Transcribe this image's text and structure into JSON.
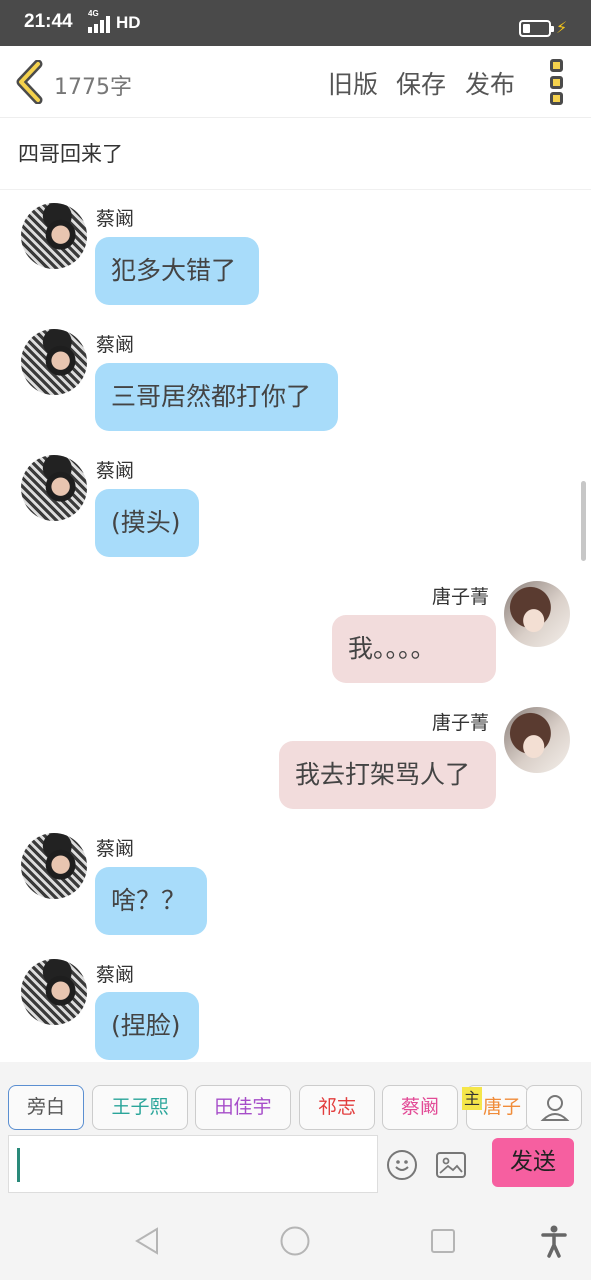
{
  "status": {
    "time": "21:44",
    "network_type": "4G",
    "signal_label": "HD"
  },
  "top_bar": {
    "word_count": "1775字",
    "actions": [
      "旧版",
      "保存",
      "发布"
    ]
  },
  "chapter": {
    "title": "四哥回来了"
  },
  "messages": [
    {
      "side": "left",
      "sender": "蔡阚",
      "text": "犯多大错了"
    },
    {
      "side": "left",
      "sender": "蔡阚",
      "text": "三哥居然都打你了"
    },
    {
      "side": "left",
      "sender": "蔡阚",
      "text": "(摸头)"
    },
    {
      "side": "right",
      "sender": "唐子菁",
      "text": "我。。。。"
    },
    {
      "side": "right",
      "sender": "唐子菁",
      "text": "我去打架骂人了"
    },
    {
      "side": "left",
      "sender": "蔡阚",
      "text": "啥？？"
    },
    {
      "side": "left",
      "sender": "蔡阚",
      "text": "(捏脸)"
    }
  ],
  "characters": [
    {
      "name": "旁白",
      "color": "#555555"
    },
    {
      "name": "王子熙",
      "color": "#2aa59a"
    },
    {
      "name": "田佳宇",
      "color": "#a64dc9"
    },
    {
      "name": "祁志",
      "color": "#e23d3d"
    },
    {
      "name": "蔡阚",
      "color": "#e24a96"
    },
    {
      "name": "唐子",
      "color": "#f08c3a"
    }
  ],
  "main_tag": "主",
  "composer": {
    "send_label": "发送"
  },
  "colors": {
    "bubble_left": "#a8dcfa",
    "bubble_right": "#f2dcdc",
    "send_button": "#f65fa0",
    "status_bar": "#4a4a4a"
  },
  "icons": {
    "back": "chevron-left-icon",
    "more": "more-vertical-icon",
    "emoji": "smiley-icon",
    "image": "image-icon",
    "person": "person-icon",
    "nav_back": "triangle-back-icon",
    "nav_home": "circle-home-icon",
    "nav_recent": "square-recent-icon",
    "accessibility": "accessibility-icon"
  }
}
